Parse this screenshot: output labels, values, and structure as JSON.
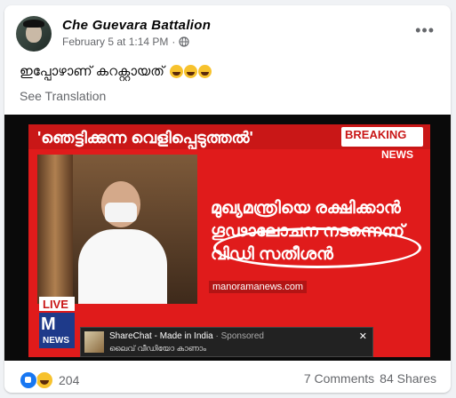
{
  "post": {
    "author": "Che Guevara Battalion",
    "date": "February 5 at 1:14 PM",
    "separator": "·",
    "privacy_icon": "globe-icon",
    "more_icon": "more-icon",
    "text": "ഇപ്പോഴാണ് കറക്റ്റായത്",
    "see_translation": "See Translation"
  },
  "media": {
    "headline_top": "'ഞെട്ടിക്കുന്ന വെളിപ്പെടുത്തൽ'",
    "breaking": "BREAKING",
    "news": "NEWS",
    "headline_line1": "മുഖ്യമന്ത്രിയെ രക്ഷിക്കാൻ",
    "headline_line2": "ഗൂഢാലോചന നടന്നെന്ന്",
    "headline_line3": "വിഡി സതീശൻ",
    "website": "manoramanews.com",
    "live": "LIVE",
    "logo_m": "M",
    "logo_news": "NEWS",
    "ad_title": "ShareChat - Made in India",
    "ad_sponsored": " · Sponsored",
    "ad_sub": "ലൈവ് വീഡിയോ കാണാം",
    "ad_close": "✕",
    "brand_red": "#e01b1b"
  },
  "footer": {
    "reaction_count": "204",
    "comments": "7 Comments",
    "shares": "84 Shares"
  }
}
